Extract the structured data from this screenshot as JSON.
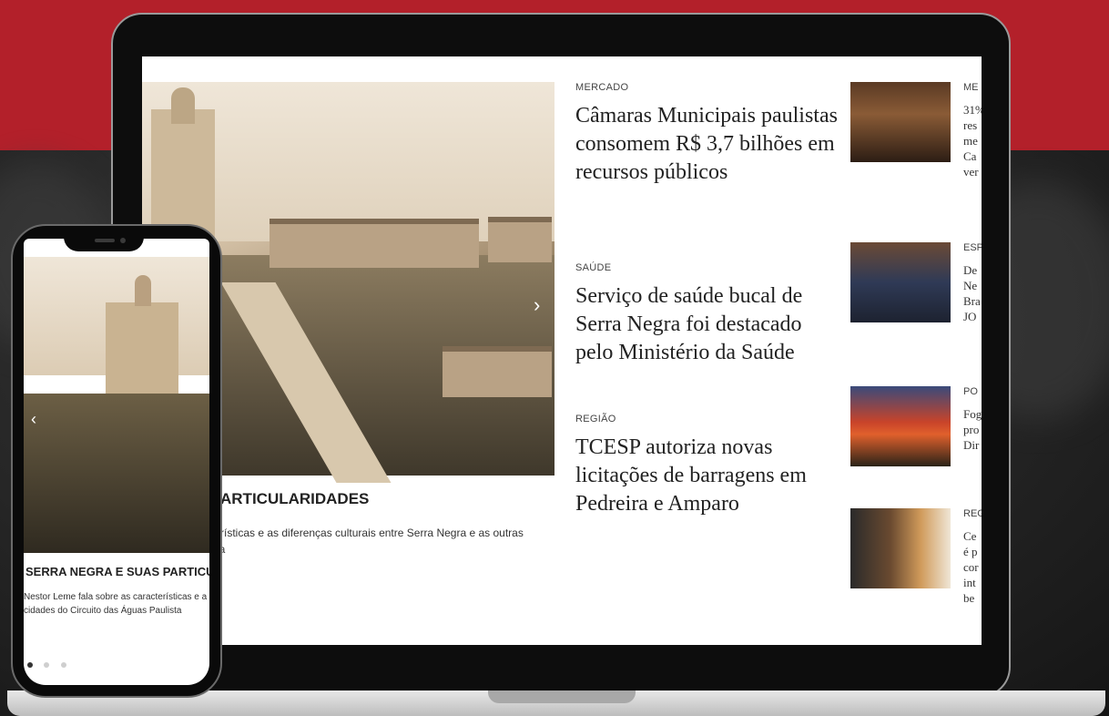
{
  "laptop": {
    "hero": {
      "title": "ARTICULARIDADES",
      "description": "cterísticas e as diferenças culturais entre Serra Negra e as outras\nlista",
      "next_icon": "›"
    },
    "articles": [
      {
        "category": "MERCADO",
        "headline": "Câmaras Municipais paulistas consomem R$ 3,7 bilhões em recursos públicos"
      },
      {
        "category": "SAÚDE",
        "headline": "Serviço de saúde bucal de Serra Negra foi destacado pelo Ministério da Saúde"
      },
      {
        "category": "REGIÃO",
        "headline": "TCESP autoriza novas licitações de barragens em Pedreira e Amparo"
      }
    ],
    "side": [
      {
        "category": "ME",
        "text": "31%\nres\nme\nCa\nver"
      },
      {
        "category": "ESP",
        "text": "De\nNe\nBra\nJO"
      },
      {
        "category": "PO",
        "text": "Fog\npro\nDir"
      },
      {
        "category": "REG",
        "text": "Ce\né p\ncor\nint\nbe"
      }
    ]
  },
  "phone": {
    "title": "SERRA NEGRA E SUAS PARTICU",
    "description": "Nestor Leme fala sobre as características e a\ncidades do Circuito das Águas Paulista",
    "prev_icon": "‹"
  },
  "colors": {
    "brand_red": "#b3202a",
    "background_dark": "#1b1b1b"
  }
}
